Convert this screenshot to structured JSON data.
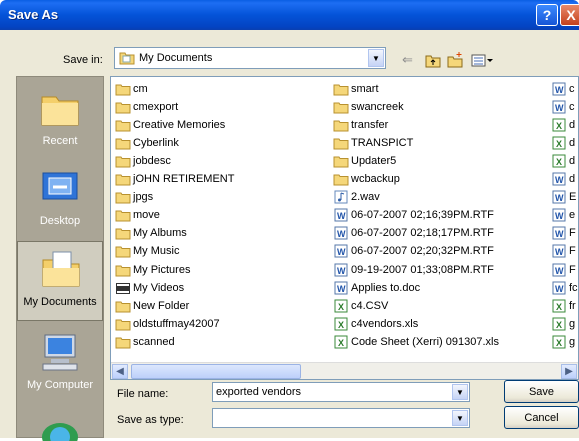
{
  "window": {
    "title": "Save As"
  },
  "title_buttons": {
    "help": "?",
    "close": "X"
  },
  "toolbar": {
    "save_in_label": "Save in:",
    "save_in_value": "My Documents",
    "icons": [
      "back-arrow-icon",
      "up-folder-icon",
      "new-folder-icon",
      "views-menu-icon"
    ]
  },
  "places": [
    {
      "label": "Recent",
      "icon": "recent-folder-icon"
    },
    {
      "label": "Desktop",
      "icon": "desktop-icon"
    },
    {
      "label": "My Documents",
      "icon": "my-documents-icon",
      "selected": true
    },
    {
      "label": "My Computer",
      "icon": "my-computer-icon"
    }
  ],
  "files": {
    "col1": [
      {
        "name": "cm",
        "type": "folder"
      },
      {
        "name": "cmexport",
        "type": "folder"
      },
      {
        "name": "Creative Memories",
        "type": "folder"
      },
      {
        "name": "Cyberlink",
        "type": "folder"
      },
      {
        "name": "jobdesc",
        "type": "folder"
      },
      {
        "name": "jOHN RETIREMENT",
        "type": "folder"
      },
      {
        "name": "jpgs",
        "type": "folder"
      },
      {
        "name": "move",
        "type": "folder"
      },
      {
        "name": "My Albums",
        "type": "folder"
      },
      {
        "name": "My Music",
        "type": "folder"
      },
      {
        "name": "My Pictures",
        "type": "folder"
      },
      {
        "name": "My Videos",
        "type": "video-folder"
      },
      {
        "name": "New Folder",
        "type": "folder"
      },
      {
        "name": "oldstuffmay42007",
        "type": "folder"
      },
      {
        "name": "scanned",
        "type": "folder"
      }
    ],
    "col2": [
      {
        "name": "smart",
        "type": "folder"
      },
      {
        "name": "swancreek",
        "type": "folder"
      },
      {
        "name": "transfer",
        "type": "folder"
      },
      {
        "name": "TRANSPICT",
        "type": "folder"
      },
      {
        "name": "Updater5",
        "type": "folder"
      },
      {
        "name": "wcbackup",
        "type": "folder"
      },
      {
        "name": "2.wav",
        "type": "audio"
      },
      {
        "name": "06-07-2007 02;16;39PM.RTF",
        "type": "doc"
      },
      {
        "name": "06-07-2007 02;18;17PM.RTF",
        "type": "doc"
      },
      {
        "name": "06-07-2007 02;20;32PM.RTF",
        "type": "doc"
      },
      {
        "name": "09-19-2007 01;33;08PM.RTF",
        "type": "doc"
      },
      {
        "name": "Applies to.doc",
        "type": "doc"
      },
      {
        "name": "c4.CSV",
        "type": "xls"
      },
      {
        "name": "c4vendors.xls",
        "type": "xls"
      },
      {
        "name": "Code Sheet (Xerri) 091307.xls",
        "type": "xls"
      }
    ],
    "col3": [
      {
        "name": "c",
        "type": "doc"
      },
      {
        "name": "c",
        "type": "doc"
      },
      {
        "name": "d",
        "type": "xls"
      },
      {
        "name": "d",
        "type": "xls"
      },
      {
        "name": "d",
        "type": "xls"
      },
      {
        "name": "d",
        "type": "doc"
      },
      {
        "name": "E",
        "type": "doc"
      },
      {
        "name": "e",
        "type": "doc"
      },
      {
        "name": "F",
        "type": "doc"
      },
      {
        "name": "F",
        "type": "doc"
      },
      {
        "name": "F",
        "type": "doc"
      },
      {
        "name": "fc",
        "type": "doc"
      },
      {
        "name": "fr",
        "type": "xls"
      },
      {
        "name": "g",
        "type": "xls"
      },
      {
        "name": "g",
        "type": "xls"
      }
    ]
  },
  "form": {
    "file_name_label": "File name:",
    "file_name_value": "exported vendors",
    "save_as_type_label": "Save as type:",
    "save_as_type_value": "",
    "save_label": "Save",
    "cancel_label": "Cancel"
  },
  "colors": {
    "title_bar": "#0453d8",
    "dialog_bg": "#ece9d8",
    "places_bg": "#aaa596",
    "folder": "#f5d77a"
  }
}
